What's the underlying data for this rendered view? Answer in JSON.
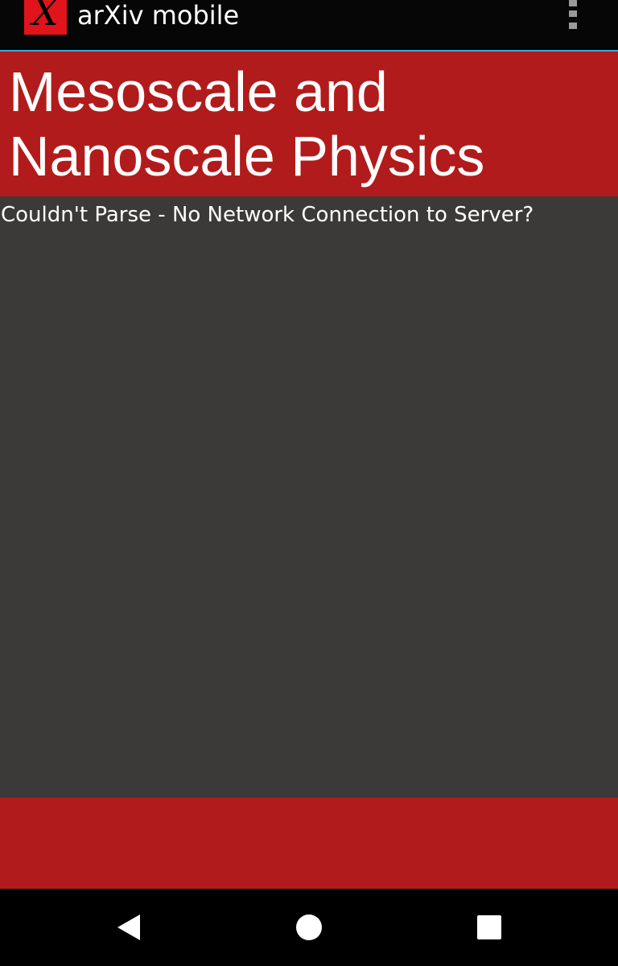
{
  "app_bar": {
    "title": "arXiv mobile",
    "logo_letter": "X",
    "logo_color": "#e0141a",
    "menu_icon": "overflow-menu-icon"
  },
  "category": {
    "title": "Mesoscale and Nanoscale Physics",
    "band_color": "#b21b1b"
  },
  "content": {
    "error_message": "Couldn't Parse - No Network Connection to Server?",
    "background_color": "#3b3a39"
  },
  "nav_bar": {
    "back_icon": "back-triangle-icon",
    "home_icon": "home-circle-icon",
    "recents_icon": "recents-square-icon"
  }
}
